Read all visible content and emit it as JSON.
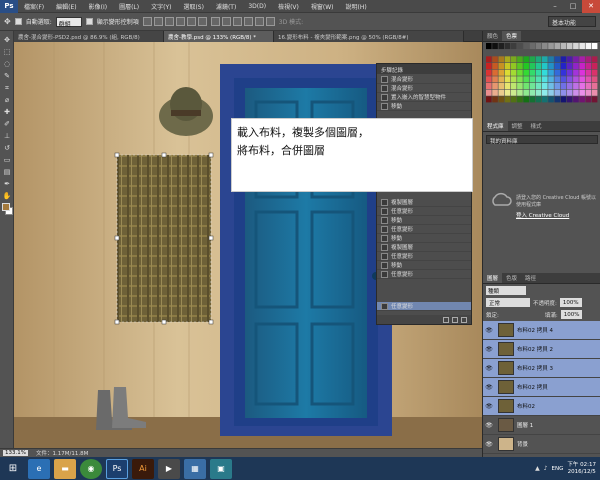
{
  "app": {
    "logo": "Ps"
  },
  "menu": [
    "檔案(F)",
    "編輯(E)",
    "影像(I)",
    "圖層(L)",
    "文字(Y)",
    "選取(S)",
    "濾鏡(T)",
    "3D(D)",
    "檢視(V)",
    "視窗(W)",
    "說明(H)"
  ],
  "window_controls": [
    "–",
    "□",
    "✕"
  ],
  "options": {
    "auto_select_label": "自動選取:",
    "auto_select_value": "群組",
    "transform_label": "顯示變形控制項",
    "mode_3d_label": "3D 模式:",
    "workspace": "基本功能"
  },
  "tabs": [
    {
      "label": "農舍-混合變形-PSD2.psd @ 86.9% (組, RGB/8)",
      "active": false
    },
    {
      "label": "農舍-教學.psd @ 133% (RGB/8) *",
      "active": true
    },
    {
      "label": "16.變形布料 - 複夾變形範案.png @ 50% (RGB/8#)",
      "active": false
    }
  ],
  "canvas": {
    "description_colors": {
      "wall": "#cdb48a",
      "door": "#1b6a92",
      "frame": "#2e4c98",
      "fabric": "#6e6138"
    }
  },
  "annotation": {
    "line1": "載入布料，複製多個圖層，",
    "line2": "將布料，合併圖層"
  },
  "history": {
    "title": "步驟記錄",
    "rows": [
      {
        "label": "混合變形"
      },
      {
        "label": "混合變形"
      },
      {
        "label": "置入嵌入的智慧型物件"
      },
      {
        "label": "移動"
      },
      {
        "label": "複製圖層"
      },
      {
        "label": "任意變形"
      },
      {
        "label": "移動"
      },
      {
        "label": "任意變形"
      },
      {
        "label": "移動"
      },
      {
        "label": "複製圖層"
      },
      {
        "label": "任意變形"
      },
      {
        "label": "移動"
      },
      {
        "label": "任意變形"
      },
      {
        "label": "任意變形",
        "selected": true
      }
    ]
  },
  "status": {
    "zoom": "133.1%",
    "doc": "文件：1.17M/11.8M"
  },
  "right": {
    "color_tabs": [
      "顏色",
      "色票"
    ],
    "lib_tabs": [
      "程式庫",
      "調整",
      "樣式"
    ],
    "lib_select": "我的資料庫",
    "cc_text": "請登入您的 Creative Cloud 帳號以使用程式庫",
    "cc_link": "登入 Creative Cloud",
    "layer_tabs": [
      "圖層",
      "色版",
      "路徑"
    ],
    "filter": "種類",
    "blend": "正常",
    "opacity_label": "不透明度:",
    "opacity": "100%",
    "lock_label": "鎖定:",
    "fill_label": "填滿:",
    "fill": "100%"
  },
  "layers": [
    {
      "name": "布料02 拷貝 4",
      "selected": true
    },
    {
      "name": "布料02 拷貝 2",
      "selected": true
    },
    {
      "name": "布料02 拷貝 3",
      "selected": true
    },
    {
      "name": "布料02 拷貝",
      "selected": true
    },
    {
      "name": "布料02",
      "selected": true
    },
    {
      "name": "圖層 1",
      "selected": false
    },
    {
      "name": "背景",
      "selected": false
    }
  ],
  "taskbar": {
    "apps": [
      "IE",
      "Folder",
      "Chrome",
      "Ps",
      "Ai"
    ],
    "lang": "ENG",
    "time": "下午 02:17",
    "date": "2016/12/5"
  }
}
